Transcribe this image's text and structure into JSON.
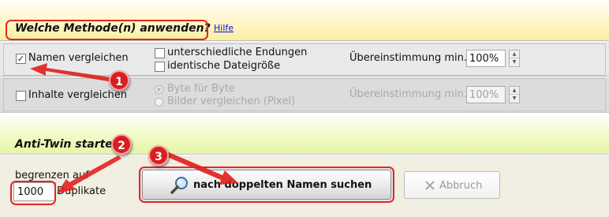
{
  "methods_section": {
    "title": "Welche Methode(n) anwenden?",
    "help_link": "Hilfe"
  },
  "names_row": {
    "compare_label": "Namen vergleichen",
    "compare_checked": true,
    "option_extensions": "unterschiedliche Endungen",
    "option_extensions_checked": false,
    "option_filesize": "identische Dateigröße",
    "option_filesize_checked": false,
    "match_label": "Übereinstimmung min.",
    "match_value": "100%"
  },
  "content_row": {
    "compare_label": "Inhalte vergleichen",
    "compare_checked": false,
    "radio_byte": "Byte für Byte",
    "radio_byte_selected": true,
    "radio_images": "Bilder vergleichen (Pixel)",
    "match_label": "Übereinstimmung min.",
    "match_value": "100%"
  },
  "start_section": {
    "title": "Anti-Twin starten"
  },
  "limit": {
    "label": "begrenzen auf",
    "value": "1000",
    "suffix": "Duplikate"
  },
  "buttons": {
    "search_label": "nach doppelten Namen suchen",
    "cancel_label": "Abbruch"
  },
  "annotations": {
    "badge_1": "1",
    "badge_2": "2",
    "badge_3": "3"
  },
  "colors": {
    "annotation_red": "#e32626",
    "link_blue": "#1010d8"
  },
  "icons": {
    "search_button_icon": "magnifier-icon",
    "cancel_button_icon": "close-x-icon"
  }
}
